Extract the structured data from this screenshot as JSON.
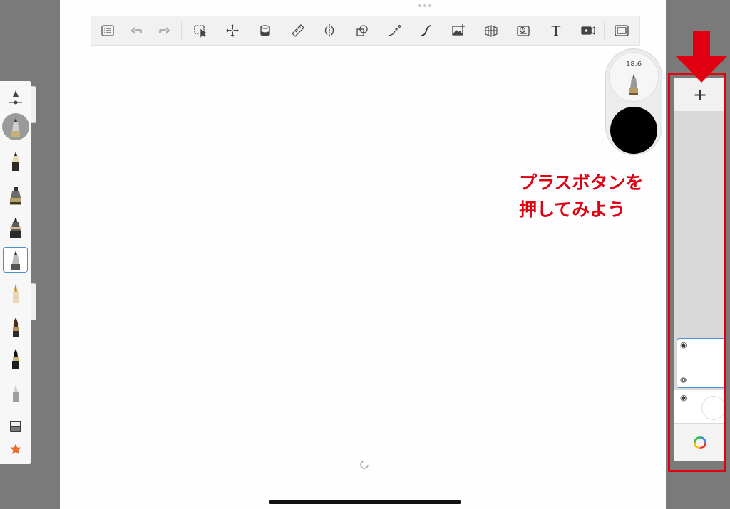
{
  "brush": {
    "size": "18.6",
    "color": "#000000"
  },
  "annotation": {
    "line1": "プラスボタンを",
    "line2": "押してみよう",
    "color": "#e00012"
  },
  "layers": {
    "add_label": "+"
  },
  "toolbar_icons": [
    "list-icon",
    "undo-icon",
    "redo-icon",
    "selection-icon",
    "transform-icon",
    "fill-icon",
    "ruler-icon",
    "symmetry-icon",
    "shapes-icon",
    "perspective-stroke-icon",
    "curve-icon",
    "import-image-icon",
    "perspective-grid-icon",
    "time-lapse-icon",
    "text-icon",
    "record-icon",
    "fullscreen-icon"
  ],
  "brush_icons": [
    "brush-settings-icon",
    "current-brush-icon",
    "pencil-icon",
    "marker-icon",
    "technical-pen-icon",
    "ballpoint-pen-icon",
    "fountain-pen-icon",
    "paintbrush-icon",
    "ink-brush-icon",
    "airbrush-icon",
    "brush-library-icon",
    "favorites-star-icon"
  ]
}
